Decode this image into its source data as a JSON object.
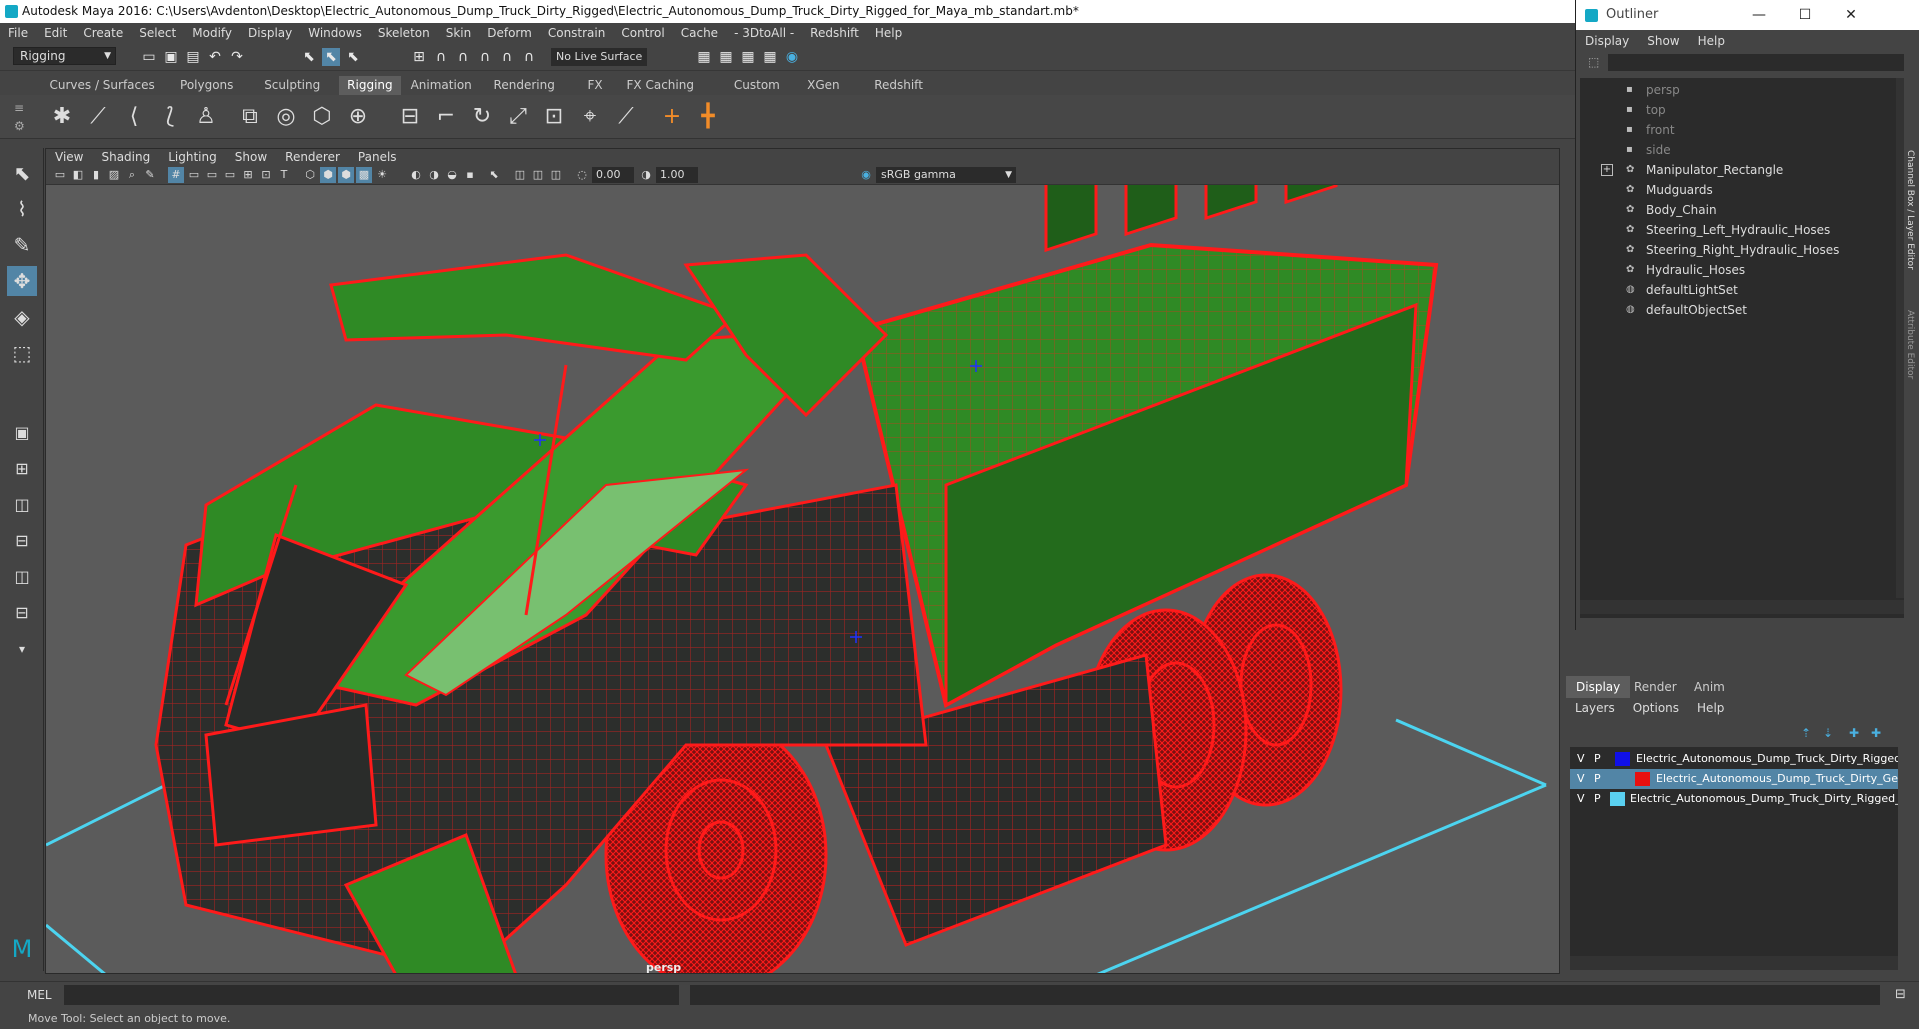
{
  "window": {
    "title": "Autodesk Maya 2016: C:\\Users\\Avdenton\\Desktop\\Electric_Autonomous_Dump_Truck_Dirty_Rigged\\Electric_Autonomous_Dump_Truck_Dirty_Rigged_for_Maya_mb_standart.mb*"
  },
  "menubar": {
    "items": [
      "File",
      "Edit",
      "Create",
      "Select",
      "Modify",
      "Display",
      "Windows",
      "Skeleton",
      "Skin",
      "Deform",
      "Constrain",
      "Control",
      "Cache",
      "- 3DtoAll -",
      "Redshift",
      "Help"
    ]
  },
  "toolbar": {
    "mode": "Rigging",
    "live_surface": "No Live Surface"
  },
  "shelf_tabs": [
    "Curves / Surfaces",
    "Polygons",
    "Sculpting",
    "Rigging",
    "Animation",
    "Rendering",
    "FX",
    "FX Caching",
    "Custom",
    "XGen",
    "Redshift"
  ],
  "active_shelf_tab": "Rigging",
  "viewport": {
    "menu": [
      "View",
      "Shading",
      "Lighting",
      "Show",
      "Renderer",
      "Panels"
    ],
    "exposure": "0.00",
    "gamma": "1.00",
    "color_space": "sRGB gamma",
    "camera_label": "persp"
  },
  "outliner": {
    "title": "Outliner",
    "menu": [
      "Display",
      "Show",
      "Help"
    ],
    "items": [
      {
        "label": "persp",
        "type": "camera"
      },
      {
        "label": "top",
        "type": "camera"
      },
      {
        "label": "front",
        "type": "camera"
      },
      {
        "label": "side",
        "type": "camera"
      },
      {
        "label": "Manipulator_Rectangle",
        "type": "group"
      },
      {
        "label": "Mudguards",
        "type": "node"
      },
      {
        "label": "Body_Chain",
        "type": "node"
      },
      {
        "label": "Steering_Left_Hydraulic_Hoses",
        "type": "node"
      },
      {
        "label": "Steering_Right_Hydraulic_Hoses",
        "type": "node"
      },
      {
        "label": "Hydraulic_Hoses",
        "type": "node"
      },
      {
        "label": "defaultLightSet",
        "type": "set"
      },
      {
        "label": "defaultObjectSet",
        "type": "set"
      }
    ]
  },
  "side_tabs": {
    "channel_box": "Channel Box / Layer Editor",
    "attribute_editor": "Attribute Editor"
  },
  "layer_editor": {
    "tabs": [
      "Display",
      "Render",
      "Anim"
    ],
    "menu": [
      "Layers",
      "Options",
      "Help"
    ],
    "layers": [
      {
        "v": "V",
        "p": "P",
        "name": "Electric_Autonomous_Dump_Truck_Dirty_Rigged_B",
        "color": "#1010e8"
      },
      {
        "v": "V",
        "p": "P",
        "name": "Electric_Autonomous_Dump_Truck_Dirty_Geom",
        "color": "#e81010"
      },
      {
        "v": "V",
        "p": "P",
        "name": "Electric_Autonomous_Dump_Truck_Dirty_Rigged_Co",
        "color": "#5ad0f0"
      }
    ]
  },
  "command_line": {
    "label": "MEL"
  },
  "status": {
    "help_line": "Move Tool: Select an object to move."
  }
}
